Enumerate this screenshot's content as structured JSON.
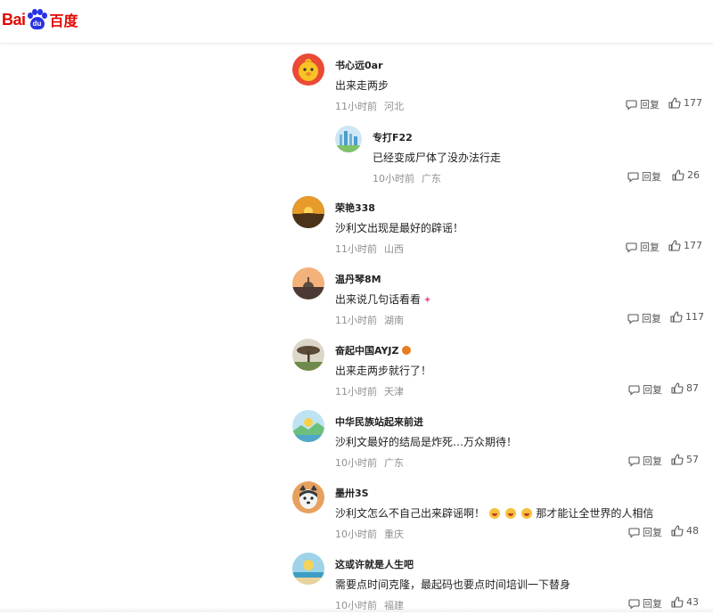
{
  "header": {
    "logo_left": "Bai",
    "logo_paw": "du",
    "logo_cn": "百度"
  },
  "comments": [
    {
      "user": "书心远0ar",
      "text": "出来走两步",
      "time": "11小时前",
      "location": "河北",
      "reply_label": "回复",
      "likes": "177",
      "avatar": "chick-avatar"
    },
    {
      "user": "专打F22",
      "text": "已经变成尸体了没办法行走",
      "time": "10小时前",
      "location": "广东",
      "reply_label": "回复",
      "likes": "26",
      "avatar": "city-avatar"
    },
    {
      "user": "荣艳338",
      "text": "沙利文出现是最好的辟谣！",
      "time": "11小时前",
      "location": "山西",
      "reply_label": "回复",
      "likes": "177",
      "avatar": "sunset-avatar"
    },
    {
      "user": "温丹琴8M",
      "text": "出来说几句话看看",
      "time": "11小时前",
      "location": "湖南",
      "reply_label": "回复",
      "likes": "117",
      "avatar": "dome-avatar"
    },
    {
      "user": "奋起中国AYJZ",
      "text": "出来走两步就行了！",
      "time": "11小时前",
      "location": "天津",
      "reply_label": "回复",
      "likes": "87",
      "avatar": "tree-avatar"
    },
    {
      "user": "中华民族站起来前进",
      "text": "沙利文最好的结局是炸死…万众期待！",
      "time": "10小时前",
      "location": "广东",
      "reply_label": "回复",
      "likes": "57",
      "avatar": "landscape-avatar"
    },
    {
      "user": "墨卅3S",
      "text_before": "沙利文怎么不自己出来辟谣啊！",
      "text_after": "那才能让全世界的人相信",
      "time": "10小时前",
      "location": "重庆",
      "reply_label": "回复",
      "likes": "48",
      "avatar": "dog-avatar"
    },
    {
      "user": "这或许就是人生吧",
      "text": "需要点时间克隆，最起码也要点时间培训一下替身",
      "time": "10小时前",
      "location": "福建",
      "reply_label": "回复",
      "likes": "43",
      "avatar": "beach-avatar"
    }
  ],
  "colors": {
    "brand_red": "#e10602",
    "brand_blue": "#2932e1",
    "meta_gray": "#8f8f8f"
  }
}
